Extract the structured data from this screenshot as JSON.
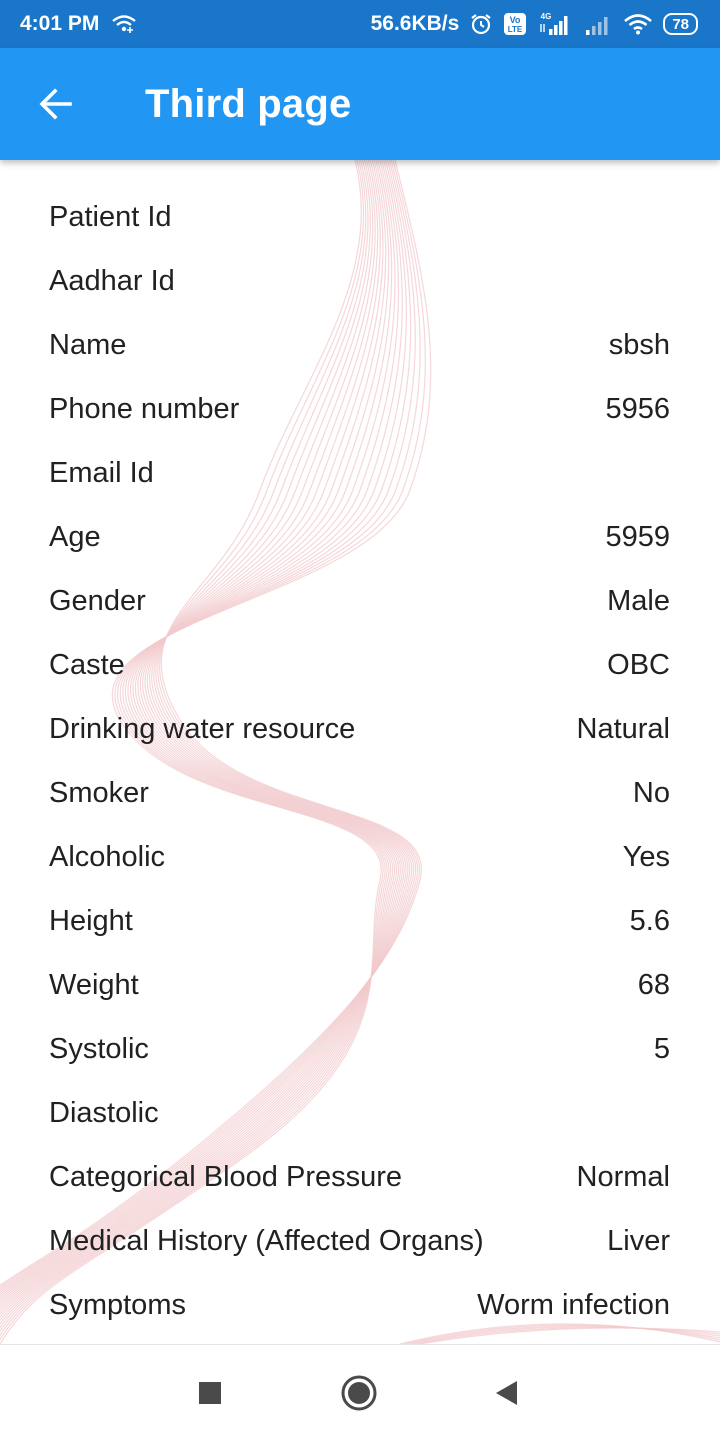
{
  "status_bar": {
    "time": "4:01 PM",
    "net_speed": "56.6KB/s",
    "network_label": "4G",
    "volte_label": "Vo LTE",
    "battery": "78",
    "icons": [
      "wifi-call-icon",
      "alarm-icon",
      "volte-icon",
      "signal-4g-icon",
      "signal-icon",
      "wifi-icon",
      "battery-icon"
    ]
  },
  "app_bar": {
    "title": "Third page",
    "back_icon": "arrow-back-icon"
  },
  "details": [
    {
      "label": "Patient Id",
      "value": ""
    },
    {
      "label": "Aadhar Id",
      "value": ""
    },
    {
      "label": "Name",
      "value": "sbsh"
    },
    {
      "label": "Phone number",
      "value": "5956"
    },
    {
      "label": "Email Id",
      "value": ""
    },
    {
      "label": "Age",
      "value": "5959"
    },
    {
      "label": "Gender",
      "value": "Male"
    },
    {
      "label": "Caste",
      "value": "OBC"
    },
    {
      "label": "Drinking water resource",
      "value": "Natural"
    },
    {
      "label": "Smoker",
      "value": "No"
    },
    {
      "label": "Alcoholic",
      "value": "Yes"
    },
    {
      "label": "Height",
      "value": "5.6"
    },
    {
      "label": "Weight",
      "value": "68"
    },
    {
      "label": "Systolic",
      "value": "5"
    },
    {
      "label": "Diastolic",
      "value": ""
    },
    {
      "label": "Categorical Blood Pressure",
      "value": "Normal"
    },
    {
      "label": "Medical History (Affected Organs)",
      "value": "Liver"
    },
    {
      "label": "Symptoms",
      "value": "Worm infection"
    }
  ],
  "nav_bar": {
    "icons": [
      "recents-square-icon",
      "home-circle-icon",
      "back-triangle-icon"
    ]
  },
  "colors": {
    "status_bar": "#1976c8",
    "app_bar": "#2196f3",
    "text": "#212121",
    "wave_lines": "#f2c9cc"
  }
}
